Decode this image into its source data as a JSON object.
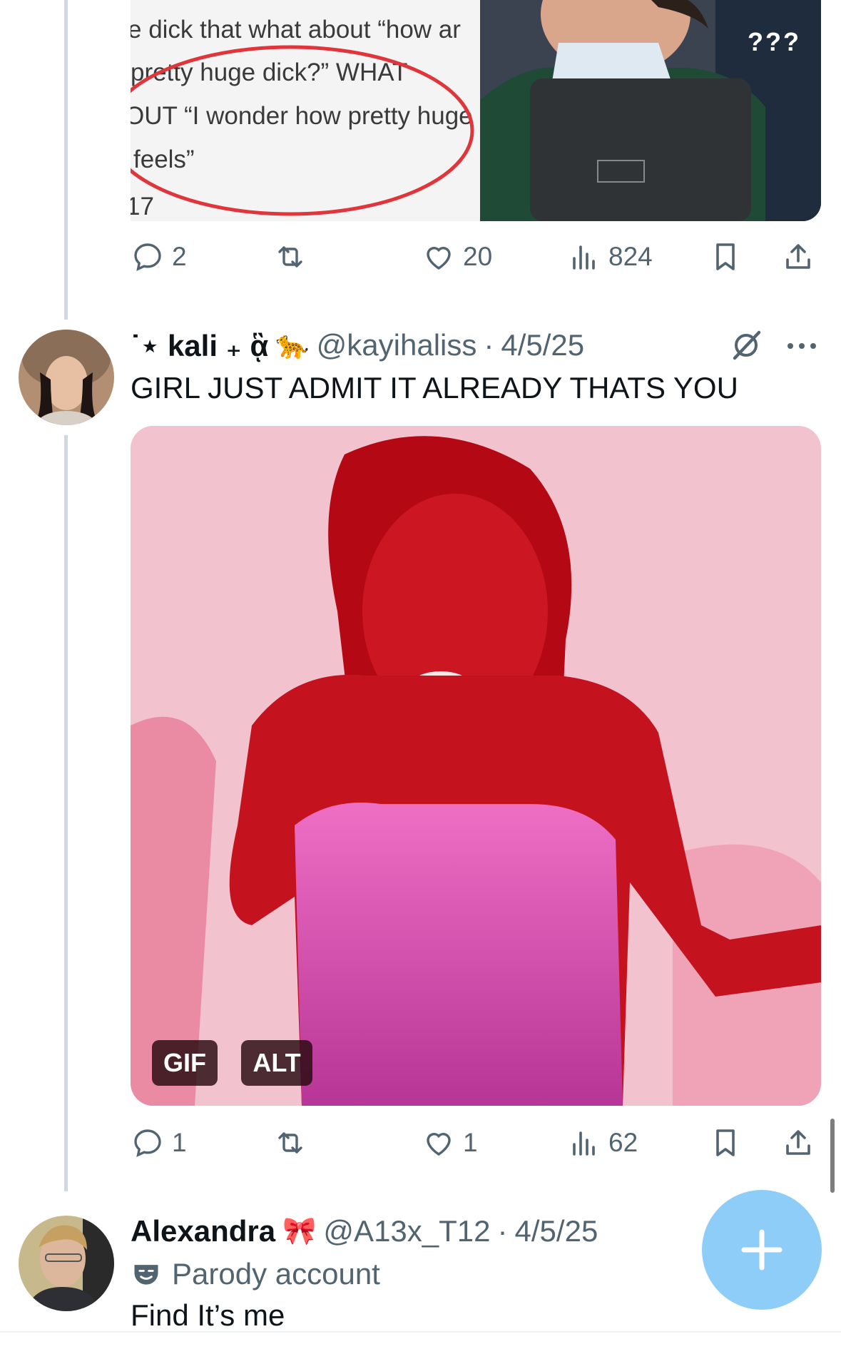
{
  "quoted_post": {
    "text_lines": [
      "e dick that what about “how ar",
      "pretty huge dick?” WHAT",
      "OUT “I wonder how pretty huge",
      "feels”",
      "17"
    ],
    "photo_badge": "???"
  },
  "post1_actions": {
    "replies": "2",
    "reposts": "",
    "likes": "20",
    "views": "824"
  },
  "post2": {
    "display_name": "˙⋆ kali ₊ ᾃ",
    "name_emoji": "🐆",
    "handle": "@kayihaliss",
    "separator": "·",
    "date": "4/5/25",
    "text": "GIRL JUST ADMIT IT ALREADY THATS YOU",
    "media_labels": {
      "gif": "GIF",
      "alt": "ALT"
    },
    "actions": {
      "replies": "1",
      "reposts": "",
      "likes": "1",
      "views": "62"
    }
  },
  "post3": {
    "display_name": "Alexandra",
    "name_emoji": "🎀",
    "handle": "@A13x_T12",
    "separator": "·",
    "date": "4/5/25",
    "badge_label": "Parody account",
    "text": "Find It’s me"
  },
  "icons": [
    "reply-icon",
    "repost-icon",
    "like-icon",
    "views-icon",
    "bookmark-icon",
    "share-icon",
    "grok-icon",
    "more-icon",
    "compose-icon",
    "parody-mask-icon"
  ],
  "colors": {
    "accent_fab": "#8ecdf8",
    "muted_text": "#536471",
    "thread_line": "#cfd9de",
    "annotation_circle": "#e0353a"
  }
}
